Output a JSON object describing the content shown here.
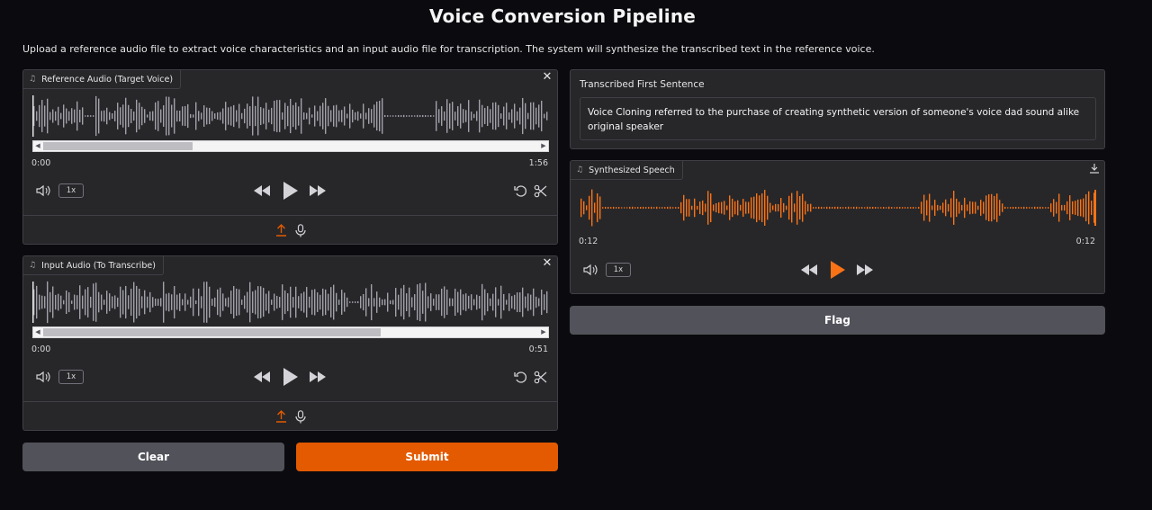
{
  "page": {
    "title": "Voice Conversion Pipeline",
    "description": "Upload a reference audio file to extract voice characteristics and an input audio file for transcription. The system will synthesize the transcribed text in the reference voice."
  },
  "reference_audio": {
    "label": "Reference Audio (Target Voice)",
    "time_start": "0:00",
    "time_end": "1:56",
    "playback_rate": "1x",
    "scroll_position": 0.3
  },
  "input_audio": {
    "label": "Input Audio (To Transcribe)",
    "time_start": "0:00",
    "time_end": "0:51",
    "playback_rate": "1x",
    "scroll_position": 0.68
  },
  "transcription": {
    "label": "Transcribed First Sentence",
    "value": "Voice Cloning referred to the purchase of creating synthetic version of someone's voice dad sound alike original speaker"
  },
  "synthesized": {
    "label": "Synthesized Speech",
    "time_current": "0:12",
    "time_end": "0:12",
    "playback_rate": "1x"
  },
  "buttons": {
    "clear": "Clear",
    "submit": "Submit",
    "flag": "Flag"
  },
  "colors": {
    "accent": "#e35a00",
    "wave_gray": "#a1a1aa",
    "wave_orange": "#f97316",
    "panel_bg": "#27272a"
  },
  "icons": {
    "music_note": "music-note-icon",
    "close": "close-icon",
    "volume": "volume-icon",
    "rewind": "rewind-icon",
    "play": "play-icon",
    "forward": "fast-forward-icon",
    "undo": "undo-icon",
    "trim": "scissors-icon",
    "upload": "upload-icon",
    "microphone": "microphone-icon",
    "download": "download-icon"
  }
}
